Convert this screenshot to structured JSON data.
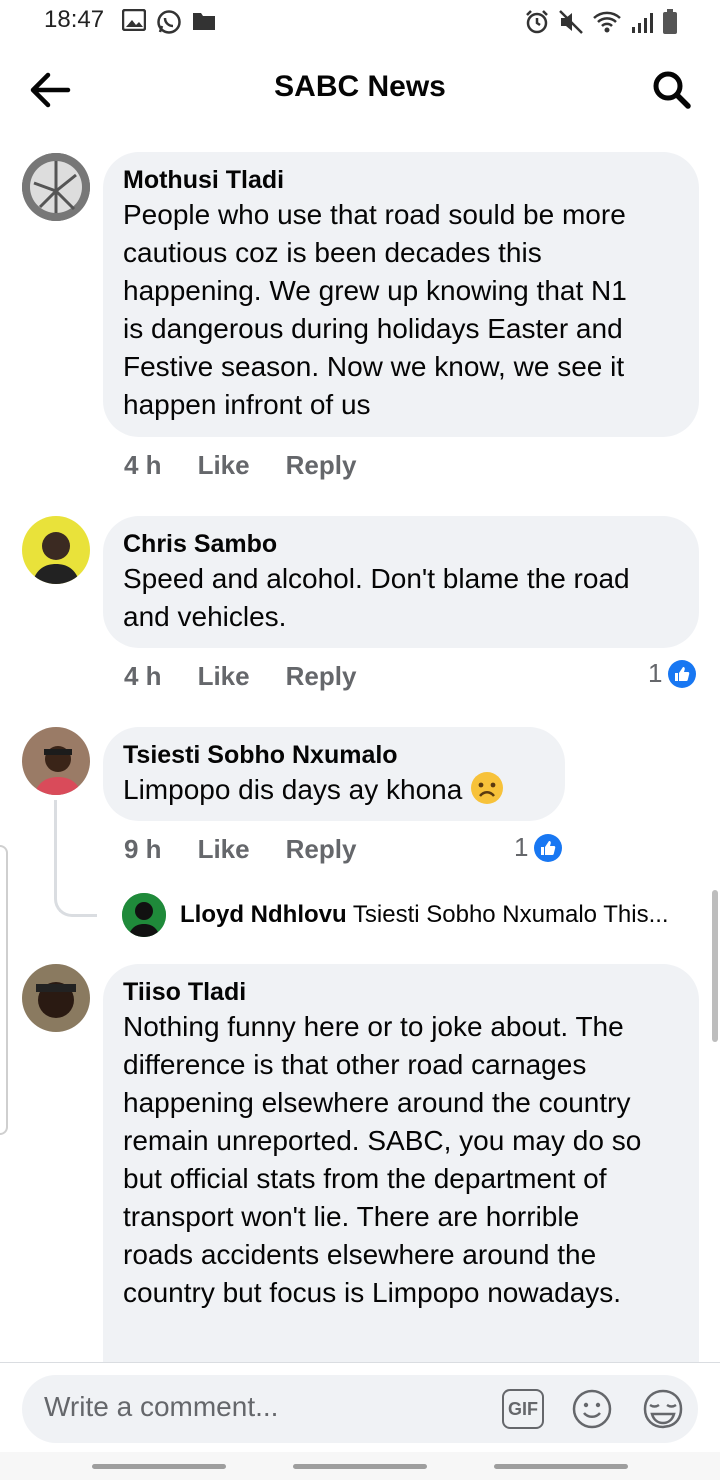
{
  "status_bar": {
    "time": "18:47"
  },
  "header": {
    "title": "SABC News"
  },
  "comments": [
    {
      "name": "Mothusi Tladi",
      "text": "People who use that road sould be more\ncautious coz is been decades this\nhappening. We grew up knowing that N1\nis dangerous during holidays Easter and\nFestive season. Now we know, we see it\nhappen infront of us",
      "time": "4 h",
      "like": "Like",
      "reply": "Reply"
    },
    {
      "name": "Chris Sambo",
      "text": "Speed and alcohol. Don't blame the road\nand vehicles.",
      "time": "4 h",
      "like": "Like",
      "reply": "Reply",
      "reactions": "1"
    },
    {
      "name": "Tsiesti Sobho Nxumalo",
      "text": "Limpopo dis days ay khona",
      "time": "9 h",
      "like": "Like",
      "reply": "Reply",
      "reactions": "1",
      "reply_preview": {
        "name": "Lloyd Ndhlovu",
        "text": "Tsiesti Sobho Nxumalo This..."
      }
    },
    {
      "name": "Tiiso Tladi",
      "text": "Nothing funny here or to joke about. The\ndifference is that other road carnages\nhappening elsewhere around the country\nremain unreported. SABC, you may do so\nbut official stats from the department of\ntransport won't lie. There are horrible\nroads accidents elsewhere around the\ncountry but focus is Limpopo nowadays."
    }
  ],
  "composer": {
    "placeholder": "Write a comment...",
    "gif": "GIF"
  },
  "colors": {
    "bubble": "#f0f2f5",
    "accent": "#1877f2",
    "meta": "#65676b"
  }
}
